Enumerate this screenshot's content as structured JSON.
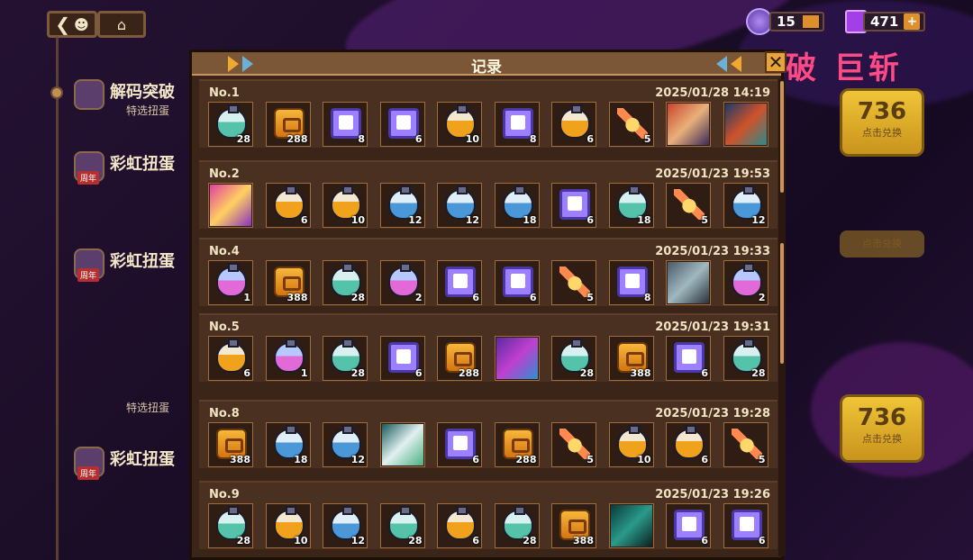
{
  "nav": {
    "back_icon": "back-mascot-icon",
    "home_icon": "home-icon"
  },
  "currency": [
    {
      "name": "ticket",
      "value": "15",
      "color": "#7a5ad8"
    },
    {
      "name": "gem",
      "value": "471",
      "color": "#a23fe8"
    }
  ],
  "side_events": [
    {
      "title": "解码突破",
      "subtitle": "特选扭蛋",
      "tag": ""
    },
    {
      "title": "彩虹扭蛋",
      "subtitle": "",
      "tag": "周年"
    },
    {
      "title": "彩虹扭蛋",
      "subtitle": "",
      "tag": "周年"
    },
    {
      "title": "",
      "subtitle": "特选扭蛋",
      "tag": ""
    },
    {
      "title": "彩虹扭蛋",
      "subtitle": "",
      "tag": "周年"
    }
  ],
  "banner": {
    "title": "破 巨斩"
  },
  "redeem": [
    {
      "value": "736",
      "label": "点击兑换"
    },
    {
      "value": "",
      "label": "点击兑换"
    },
    {
      "value": "736",
      "label": "点击兑换"
    }
  ],
  "modal": {
    "title": "记录",
    "records": [
      {
        "no": "No.1",
        "datetime": "2025/01/28 14:19",
        "items": [
          {
            "kind": "potion-teal",
            "qty": "28"
          },
          {
            "kind": "coin",
            "qty": "288"
          },
          {
            "kind": "shirt",
            "qty": "8"
          },
          {
            "kind": "shirt",
            "qty": "6"
          },
          {
            "kind": "potion-orange",
            "qty": "10"
          },
          {
            "kind": "shirt",
            "qty": "8"
          },
          {
            "kind": "potion-orange",
            "qty": "6"
          },
          {
            "kind": "candy",
            "qty": "5"
          },
          {
            "kind": "portrait-a",
            "qty": ""
          },
          {
            "kind": "portrait-b",
            "qty": ""
          }
        ]
      },
      {
        "no": "No.2",
        "datetime": "2025/01/23 19:53",
        "items": [
          {
            "kind": "portrait-c",
            "qty": ""
          },
          {
            "kind": "potion-orange",
            "qty": "6"
          },
          {
            "kind": "potion-orange",
            "qty": "10"
          },
          {
            "kind": "potion-blue",
            "qty": "12"
          },
          {
            "kind": "potion-blue",
            "qty": "12"
          },
          {
            "kind": "potion-blue",
            "qty": "18"
          },
          {
            "kind": "shirt",
            "qty": "6"
          },
          {
            "kind": "potion-teal",
            "qty": "18"
          },
          {
            "kind": "candy",
            "qty": "5"
          },
          {
            "kind": "potion-blue",
            "qty": "12"
          }
        ]
      },
      {
        "no": "No.4",
        "datetime": "2025/01/23 19:33",
        "items": [
          {
            "kind": "potion-pink",
            "qty": "1"
          },
          {
            "kind": "coin",
            "qty": "388"
          },
          {
            "kind": "potion-teal",
            "qty": "28"
          },
          {
            "kind": "potion-pink",
            "qty": "2"
          },
          {
            "kind": "shirt",
            "qty": "6"
          },
          {
            "kind": "shirt",
            "qty": "6"
          },
          {
            "kind": "candy",
            "qty": "5"
          },
          {
            "kind": "shirt",
            "qty": "8"
          },
          {
            "kind": "portrait-d",
            "qty": ""
          },
          {
            "kind": "potion-pink",
            "qty": "2"
          }
        ]
      },
      {
        "no": "No.5",
        "datetime": "2025/01/23 19:31",
        "items": [
          {
            "kind": "potion-orange",
            "qty": "6"
          },
          {
            "kind": "potion-pink",
            "qty": "1"
          },
          {
            "kind": "potion-teal",
            "qty": "28"
          },
          {
            "kind": "shirt",
            "qty": "6"
          },
          {
            "kind": "coin",
            "qty": "288"
          },
          {
            "kind": "portrait-e",
            "qty": ""
          },
          {
            "kind": "potion-teal",
            "qty": "28"
          },
          {
            "kind": "coin",
            "qty": "388"
          },
          {
            "kind": "shirt",
            "qty": "6"
          },
          {
            "kind": "potion-teal",
            "qty": "28"
          }
        ]
      },
      {
        "no": "No.8",
        "datetime": "2025/01/23 19:28",
        "items": [
          {
            "kind": "coin",
            "qty": "388"
          },
          {
            "kind": "potion-blue",
            "qty": "18"
          },
          {
            "kind": "potion-blue",
            "qty": "12"
          },
          {
            "kind": "portrait-f",
            "qty": ""
          },
          {
            "kind": "shirt",
            "qty": "6"
          },
          {
            "kind": "coin",
            "qty": "288"
          },
          {
            "kind": "candy",
            "qty": "5"
          },
          {
            "kind": "potion-orange",
            "qty": "10"
          },
          {
            "kind": "potion-orange",
            "qty": "6"
          },
          {
            "kind": "candy",
            "qty": "5"
          }
        ]
      },
      {
        "no": "No.9",
        "datetime": "2025/01/23 19:26",
        "items": [
          {
            "kind": "potion-teal",
            "qty": "28"
          },
          {
            "kind": "potion-orange",
            "qty": "10"
          },
          {
            "kind": "potion-blue",
            "qty": "12"
          },
          {
            "kind": "potion-teal",
            "qty": "28"
          },
          {
            "kind": "potion-orange",
            "qty": "6"
          },
          {
            "kind": "potion-teal",
            "qty": "28"
          },
          {
            "kind": "coin",
            "qty": "388"
          },
          {
            "kind": "portrait-g",
            "qty": ""
          },
          {
            "kind": "shirt",
            "qty": "6"
          },
          {
            "kind": "shirt",
            "qty": "6"
          }
        ]
      }
    ]
  }
}
